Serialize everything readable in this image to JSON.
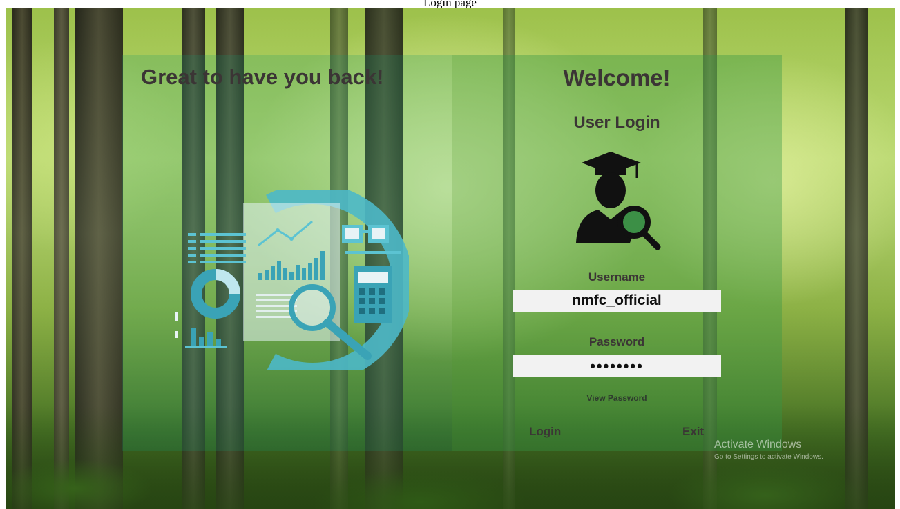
{
  "caption": "Login page",
  "left_panel": {
    "title": "Great to have you back!"
  },
  "right_panel": {
    "welcome": "Welcome!",
    "heading": "User Login",
    "username_label": "Username",
    "username_value": "nmfc_official",
    "password_label": "Password",
    "password_value": "••••••••",
    "view_password": "View Password",
    "login_label": "Login",
    "exit_label": "Exit"
  },
  "watermark": {
    "line1": "Activate Windows",
    "line2": "Go to Settings to activate Windows."
  },
  "colors": {
    "panel_left": "#16966e",
    "panel_right": "#349646",
    "illustration_teal": "#4db8c8",
    "text_dark": "#3b3535"
  },
  "icons": [
    "graduate-user-search-icon",
    "data-analysis-illustration"
  ]
}
